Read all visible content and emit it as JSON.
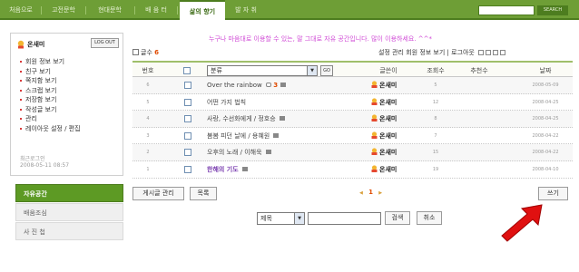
{
  "nav": {
    "items": [
      {
        "label": "처음으로",
        "active": false
      },
      {
        "label": "고전문학",
        "active": false
      },
      {
        "label": "현대문학",
        "active": false
      },
      {
        "label": "배 움 터",
        "active": false
      },
      {
        "label": "삶의 향기",
        "active": true
      },
      {
        "label": "발 자 취",
        "active": false
      }
    ],
    "search_label": "SEARCH"
  },
  "user": {
    "name": "온새미",
    "logout_label": "LOG OUT",
    "menu": [
      "회원 정보 보기",
      "친구 보기",
      "쪽지함 보기",
      "스크랩 보기",
      "저장함 보기",
      "작성글 보기",
      "관리",
      "레이아웃 설정 / 편집"
    ],
    "last_login_label": "최근로그인",
    "last_login_value": "2008-05-11 08:57"
  },
  "leftnav": {
    "items": [
      {
        "label": "자유공간",
        "active": true
      },
      {
        "label": "배움조심",
        "active": false
      },
      {
        "label": "사 진 첩",
        "active": false
      }
    ]
  },
  "board": {
    "welcome": "누구나 마음대로 이용할 수 있는, 말 그대로 자유 공간입니다. 많이 이용하세요. ^^*",
    "post_count_label": "글수",
    "post_count": "6",
    "tools": "설정  관리  회원 정보 보기 | 로그아웃",
    "headers": {
      "no": "번호",
      "category": "분류",
      "go": "GO",
      "author": "글쓴이",
      "views": "조회수",
      "recommend": "추천수",
      "date": "날짜"
    },
    "rows": [
      {
        "no": "6",
        "title": "Over the rainbow",
        "comments": "3",
        "author": "온새미",
        "views": "5",
        "date": "2008-05-09",
        "purple": false
      },
      {
        "no": "5",
        "title": "어떤 가지 법칙",
        "comments": "",
        "author": "온새미",
        "views": "12",
        "date": "2008-04-25",
        "purple": false
      },
      {
        "no": "4",
        "title": "사랑, 수선화에게 / 정호승",
        "comments": "",
        "author": "온새미",
        "views": "8",
        "date": "2008-04-25",
        "purple": false
      },
      {
        "no": "3",
        "title": "봄봄 피던 날에 / 용혜원",
        "comments": "",
        "author": "온새미",
        "views": "7",
        "date": "2008-04-22",
        "purple": false
      },
      {
        "no": "2",
        "title": "오후의 노래 / 이해욱",
        "comments": "",
        "author": "온새미",
        "views": "15",
        "date": "2008-04-22",
        "purple": false
      },
      {
        "no": "1",
        "title": "한해의 기도",
        "comments": "",
        "author": "온새미",
        "views": "19",
        "date": "2008-04-10",
        "purple": true
      }
    ],
    "manage_label": "게시글 관리",
    "list_label": "목록",
    "pager_prev": "◀",
    "pager_current": "1",
    "pager_next": "▶",
    "write_label": "쓰기",
    "search_select": "제목",
    "search_button": "검색",
    "cancel_button": "취소"
  },
  "colors": {
    "nav_green": "#6e9e36",
    "active_left": "#5d9a24",
    "welcome_pink": "#d04bd6",
    "accent_orange": "#e04a00",
    "arrow_red": "#e01010"
  }
}
